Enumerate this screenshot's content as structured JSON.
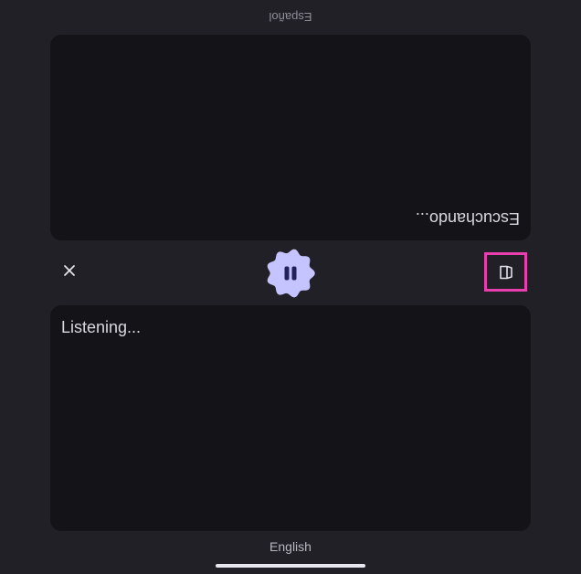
{
  "top_panel": {
    "language_label": "Español",
    "status_text": "Escuchando..."
  },
  "controls": {
    "close_icon": "close-icon",
    "pause_icon": "pause-icon",
    "book_icon": "book-icon",
    "pause_button_color": "#c5c4ff",
    "pause_glyph_color": "#22215a"
  },
  "bottom_panel": {
    "status_text": "Listening...",
    "language_label": "English"
  },
  "colors": {
    "background": "#212027",
    "panel": "#141317",
    "highlight": "#e83fae"
  }
}
